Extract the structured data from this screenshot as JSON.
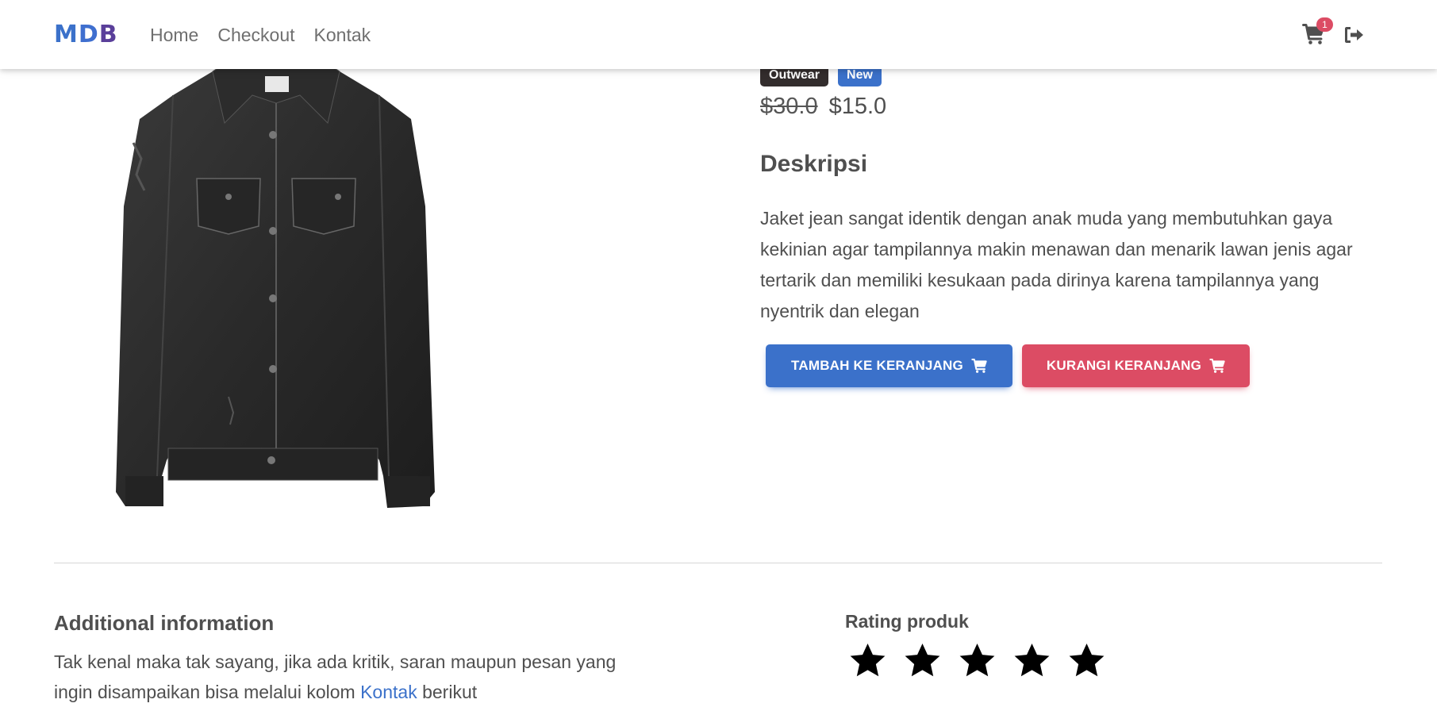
{
  "navbar": {
    "brand": [
      "M",
      "D",
      "B"
    ],
    "links": [
      "Home",
      "Checkout",
      "Kontak"
    ],
    "cart_count": "1"
  },
  "product": {
    "tags": [
      "Outwear",
      "New"
    ],
    "old_price": "$30.0",
    "price": "$15.0",
    "description_heading": "Deskripsi",
    "description": "Jaket jean sangat identik dengan anak muda yang membutuhkan gaya kekinian agar tampilannya makin menawan dan menarik lawan jenis agar tertarik dan memiliki kesukaan pada dirinya karena tampilannya yang nyentrik dan elegan",
    "add_button": "Tambah ke keranjang",
    "remove_button": "Kurangi keranjang"
  },
  "additional": {
    "heading": "Additional information",
    "text_before": "Tak kenal maka tak sayang, jika ada kritik, saran maupun pesan yang ingin disampaikan bisa melalui kolom ",
    "link": "Kontak",
    "text_after": " berikut"
  },
  "rating": {
    "heading": "Rating produk",
    "stars": 5,
    "max": 5
  },
  "colors": {
    "primary": "#3b71ca",
    "danger": "#dc4c64",
    "dark": "#332d2d"
  }
}
